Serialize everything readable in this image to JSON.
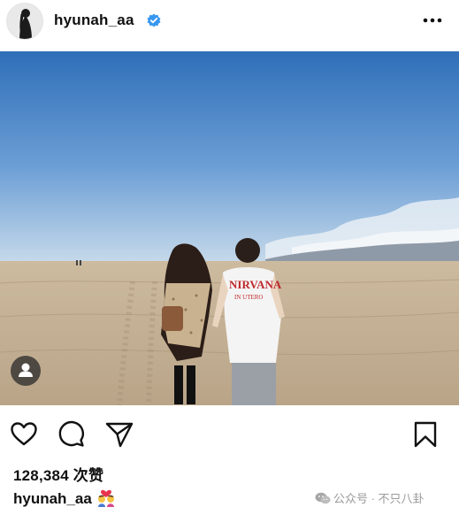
{
  "post": {
    "username": "hyunah_aa",
    "verified": true,
    "likes_text": "128,384 次赞",
    "caption_username": "hyunah_aa",
    "caption_emoji": "couple-kiss-emoji"
  },
  "icons": {
    "more": "more-horizontal-icon",
    "tag": "user-tag-icon",
    "like": "heart-icon",
    "comment": "comment-bubble-icon",
    "share": "send-paper-plane-icon",
    "save": "bookmark-icon",
    "verified": "verified-badge-icon"
  },
  "watermark": {
    "text": "公众号 · 不只八卦",
    "logo": "wechat-icon"
  },
  "colors": {
    "verified_blue": "#3897f0",
    "text": "#111111",
    "watermark": "#9a9a9a"
  }
}
